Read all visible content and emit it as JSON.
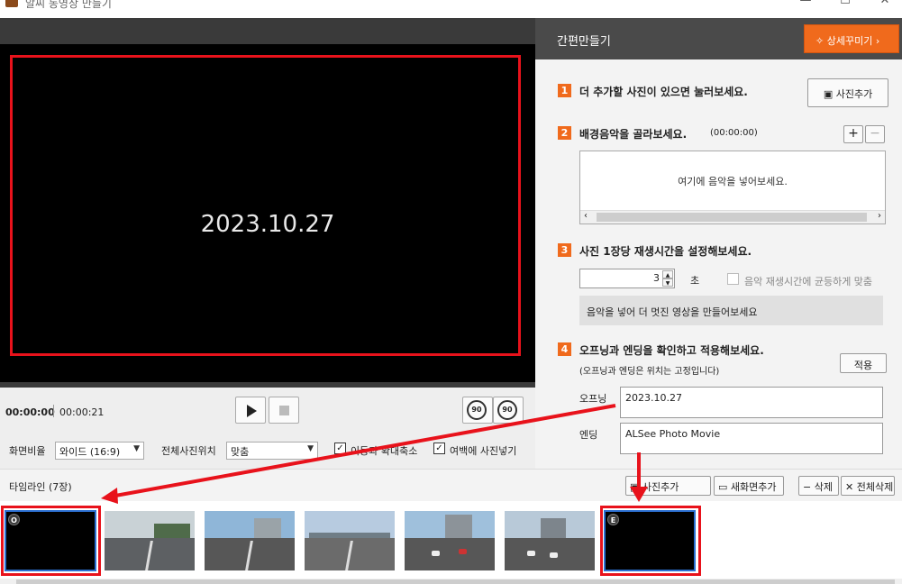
{
  "window": {
    "title": "알씨 동영상 만들기"
  },
  "preview": {
    "text": "2023.10.27"
  },
  "player": {
    "current_time": "00:00:00",
    "total_time": "00:00:21",
    "rotate_left_label": "90",
    "rotate_right_label": "90"
  },
  "options": {
    "ratio_label": "화면비율",
    "ratio_value": "와이드 (16:9)",
    "position_label": "전체사진위치",
    "position_value": "맞춤",
    "move_zoom_label": "이동과 확대축소",
    "margin_label": "여백에 사진넣기"
  },
  "right": {
    "title": "간편만들기",
    "detail_button": "상세꾸미기",
    "step1": {
      "num": "1",
      "text": "더 추가할 사진이 있으면 눌러보세요.",
      "button": "사진추가"
    },
    "step2": {
      "num": "2",
      "text": "배경음악을 골라보세요.",
      "sub": "(00:00:00)",
      "placeholder": "여기에 음악을 넣어보세요."
    },
    "step3": {
      "num": "3",
      "text": "사진 1장당 재생시간을 설정해보세요.",
      "value": "3",
      "unit": "초",
      "sync_label": "음악 재생시간에 균등하게 맞춤",
      "hint": "음악을 넣어 더 멋진 영상을 만들어보세요"
    },
    "step4": {
      "num": "4",
      "text": "오프닝과 엔딩을 확인하고 적용해보세요.",
      "sub": "(오프닝과 엔딩은 위치는 고정입니다)",
      "apply_button": "적용",
      "opening_label": "오프닝",
      "opening_value": "2023.10.27",
      "ending_label": "엔딩",
      "ending_value": "ALSee Photo Movie"
    }
  },
  "timeline": {
    "title": "타임라인",
    "count": "(7장)",
    "add_photo": "사진추가",
    "new_screen": "새화면추가",
    "delete": "삭제",
    "delete_all": "전체삭제",
    "opening_badge": "O",
    "ending_badge": "E"
  },
  "colors": {
    "accent": "#f06a1c",
    "highlight_red": "#e8121b",
    "selection_blue": "#2b6fd1"
  }
}
